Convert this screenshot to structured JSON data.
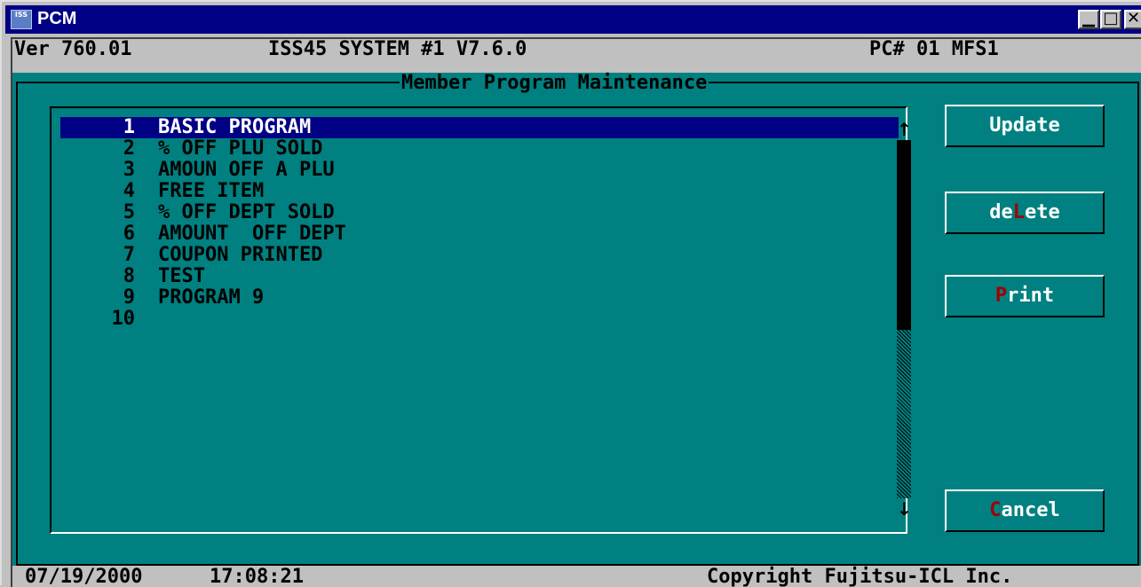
{
  "window": {
    "title": "PCM",
    "icon_label": "ISS",
    "buttons": [
      "minimize",
      "maximize",
      "close"
    ]
  },
  "header": {
    "version": "Ver 760.01",
    "system": "ISS45 SYSTEM #1 V7.6.0",
    "pc": "PC# 01 MFS1"
  },
  "dialog": {
    "title": "Member Program Maintenance",
    "selected_index": 0,
    "items": [
      {
        "num": "1",
        "label": "BASIC PROGRAM"
      },
      {
        "num": "2",
        "label": "% OFF PLU SOLD"
      },
      {
        "num": "3",
        "label": "AMOUN OFF A PLU"
      },
      {
        "num": "4",
        "label": "FREE ITEM"
      },
      {
        "num": "5",
        "label": "% OFF DEPT SOLD"
      },
      {
        "num": "6",
        "label": "AMOUNT  OFF DEPT"
      },
      {
        "num": "7",
        "label": "COUPON PRINTED"
      },
      {
        "num": "8",
        "label": "TEST"
      },
      {
        "num": "9",
        "label": "PROGRAM 9"
      },
      {
        "num": "10",
        "label": ""
      }
    ],
    "scroll": {
      "up_icon": "arrow-up-icon",
      "down_icon": "arrow-down-icon"
    }
  },
  "buttons": {
    "update": {
      "pre": "",
      "hot": "U",
      "post": "pdate"
    },
    "delete": {
      "pre": "de",
      "hot": "L",
      "post": "ete"
    },
    "print": {
      "pre": "",
      "hot": "P",
      "post": "rint"
    },
    "cancel": {
      "pre": "",
      "hot": "C",
      "post": "ancel"
    }
  },
  "status": {
    "date": "07/19/2000",
    "time": "17:08:21",
    "copyright": "Copyright Fujitsu-ICL Inc."
  },
  "colors": {
    "title_bar": "#000084",
    "background": "#008080",
    "selection": "#000084",
    "hotkey": "#a00000"
  }
}
